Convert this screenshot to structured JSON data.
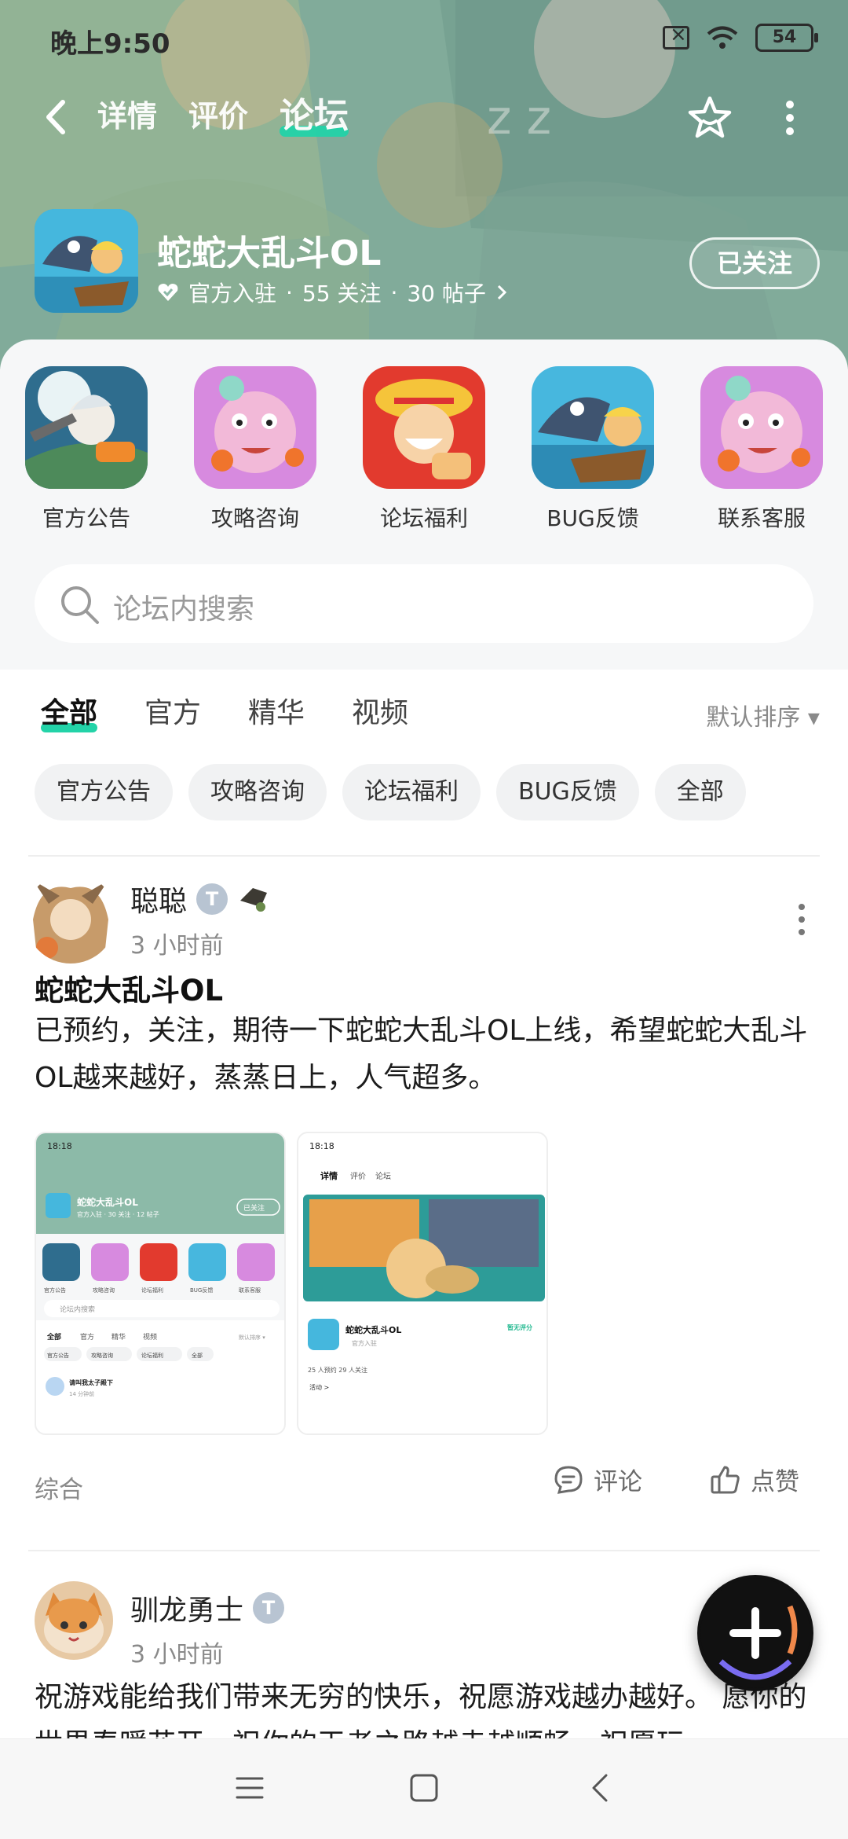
{
  "status_bar": {
    "time": "晚上9:50",
    "battery": "54"
  },
  "topnav": {
    "tabs": [
      {
        "label": "详情"
      },
      {
        "label": "评价"
      },
      {
        "label": "论坛"
      }
    ],
    "active_tab": 2
  },
  "game": {
    "name": "蛇蛇大乱斗OL",
    "official": "官方入驻",
    "followers": "55 关注",
    "posts": "30 帖子",
    "sep": "·",
    "follow_label": "已关注"
  },
  "categories": [
    {
      "label": "官方公告",
      "icon": "announcement-art"
    },
    {
      "label": "攻略咨询",
      "icon": "guide-art"
    },
    {
      "label": "论坛福利",
      "icon": "welfare-art"
    },
    {
      "label": "BUG反馈",
      "icon": "bug-art"
    },
    {
      "label": "联系客服",
      "icon": "support-art"
    }
  ],
  "search": {
    "placeholder": "论坛内搜索"
  },
  "filter_tabs": [
    {
      "label": "全部"
    },
    {
      "label": "官方"
    },
    {
      "label": "精华"
    },
    {
      "label": "视频"
    }
  ],
  "sort": {
    "label": "默认排序 ▾"
  },
  "chips": [
    {
      "label": "官方公告"
    },
    {
      "label": "攻略咨询"
    },
    {
      "label": "论坛福利"
    },
    {
      "label": "BUG反馈"
    },
    {
      "label": "全部"
    }
  ],
  "posts": [
    {
      "user": "聪聪",
      "time": "3 小时前",
      "title": "蛇蛇大乱斗OL",
      "body": "已预约，关注，期待一下蛇蛇大乱斗OL上线，希望蛇蛇大乱斗OL越来越好，蒸蒸日上，人气超多。",
      "tag": "综合",
      "comment_label": "评论",
      "like_label": "点赞",
      "thumb1": {
        "time": "18:18",
        "game": "蛇蛇大乱斗OL",
        "meta": "官方入驻 · 30 关注 · 12 帖子",
        "follow": "已关注",
        "cats": [
          "官方公告",
          "攻略咨询",
          "论坛福利",
          "BUG反馈",
          "联系客服"
        ],
        "search": "论坛内搜索",
        "tabs": [
          "全部",
          "官方",
          "精华",
          "视频"
        ],
        "sort": "默认排序 ▾",
        "chips": [
          "官方公告",
          "攻略咨询",
          "论坛福利",
          "全部"
        ],
        "post_user": "请叫我太子殿下",
        "post_time": "14 分钟前"
      },
      "thumb2": {
        "time": "18:18",
        "tabs": [
          "详情",
          "评价",
          "论坛"
        ],
        "game": "蛇蛇大乱斗OL",
        "official": "官方入驻",
        "no_rating": "暂无评分",
        "stats": "25 人预约   29 人关注",
        "activity": "活动 >"
      }
    },
    {
      "user": "驯龙勇士",
      "time": "3 小时前",
      "body": "祝游戏能给我们带来无穷的快乐，祝愿游戏越办越好。 愿你的世界春暖花开，祝你的王者之路越走越顺畅，祝愿玩"
    }
  ],
  "colors": {
    "accent": "#23d3a8",
    "banner": "#8fbfae"
  }
}
